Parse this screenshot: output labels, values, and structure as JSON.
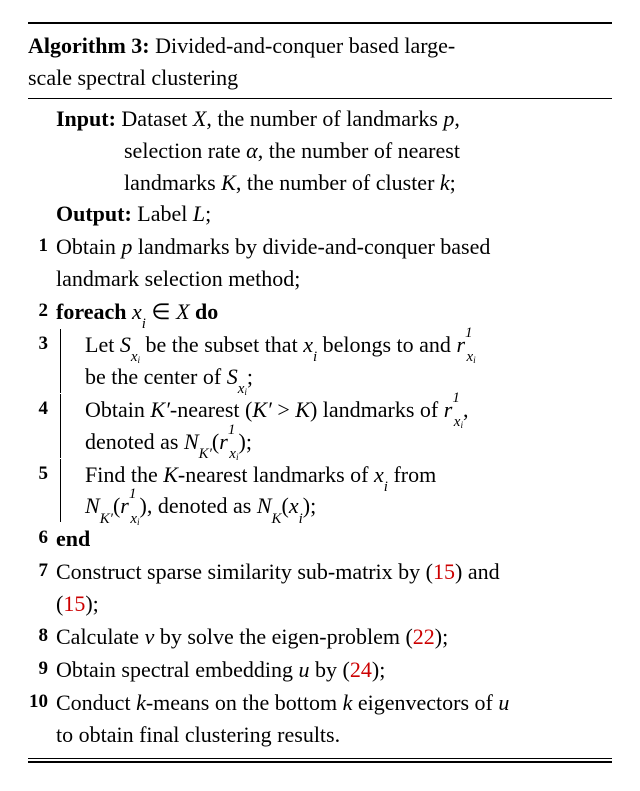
{
  "algo": {
    "label": "Algorithm 3:",
    "title_line1": " Divided-and-conquer based large-",
    "title_line2": "scale spectral clustering",
    "input_label": "Input:",
    "input_l1": " Dataset ",
    "input_X": "X",
    "input_l1b": ", the number of landmarks ",
    "input_p": "p",
    "input_l1c": ",",
    "input_l2a": "selection rate ",
    "input_alpha": "α",
    "input_l2b": ", the number of nearest",
    "input_l3a": "landmarks ",
    "input_K": "K",
    "input_l3b": ", the number of cluster ",
    "input_k": "k",
    "input_l3c": ";",
    "output_label": "Output:",
    "output_text": " Label ",
    "output_L": "L",
    "output_semi": ";",
    "n1": "1",
    "s1a": "Obtain ",
    "s1p": "p",
    "s1b": " landmarks by divide-and-conquer based",
    "s1c": "landmark selection method;",
    "n2": "2",
    "foreach": "foreach ",
    "foreach_var": "x",
    "foreach_sub": "i",
    "foreach_in": " ∈ ",
    "foreach_set": "X",
    "do": " do",
    "n3": "3",
    "s3a": "Let ",
    "s3S": "S",
    "s3b": " be the subset that ",
    "s3x": "x",
    "s3i": "i",
    "s3c": " belongs to and ",
    "s3r": "r",
    "s3sup": "1",
    "s3d": "be the center of ",
    "s3semi": ";",
    "n4": "4",
    "s4a": "Obtain ",
    "s4K": "K",
    "s4prime": "′",
    "s4b": "-nearest (",
    "s4gt": " > ",
    "s4c": ") landmarks of ",
    "s4d": "denoted as ",
    "s4N": "N",
    "s4e": ";",
    "s4comma": ",",
    "n5": "5",
    "s5a": "Find the ",
    "s5K": "K",
    "s5b": "-nearest landmarks of ",
    "s5c": " from",
    "s5d": ", denoted as ",
    "s5e": ";",
    "n6": "6",
    "end": "end",
    "n7": "7",
    "s7a": "Construct sparse similarity sub-matrix by (",
    "s7ref1": "15",
    "s7b": ") and",
    "s7c": "(",
    "s7ref2": "15",
    "s7d": ");",
    "n8": "8",
    "s8a": "Calculate ",
    "s8v": "v",
    "s8b": " by solve the eigen-problem (",
    "s8ref": "22",
    "s8c": ");",
    "n9": "9",
    "s9a": "Obtain spectral embedding ",
    "s9u": "u",
    "s9b": " by (",
    "s9ref": "24",
    "s9c": ");",
    "n10": "10",
    "s10a": "Conduct ",
    "s10k": "k",
    "s10b": "-means on the bottom ",
    "s10c": " eigenvectors of ",
    "s10u": "u",
    "s10d": "to obtain final clustering results."
  }
}
